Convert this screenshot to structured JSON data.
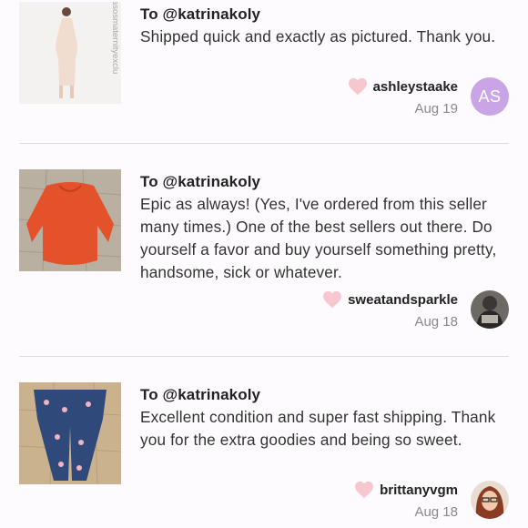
{
  "reviews": [
    {
      "to": "To @katrinakoly",
      "message": "Shipped quick and exactly as pictured. Thank you.",
      "username": "ashleystaake",
      "date": "Aug 19",
      "avatar_initials": "AS",
      "thumb_text": "asosmaternityexclu",
      "avatar_color": "#c9a4e6"
    },
    {
      "to": "To @katrinakoly",
      "message": "Epic as always! (Yes, I've ordered from this seller many times.) One of the best sellers out there. Do yourself a favor and buy yourself something pretty, handsome, sick or whatever.",
      "username": "sweatandsparkle",
      "date": "Aug 18"
    },
    {
      "to": "To @katrinakoly",
      "message": "Excellent condition and super fast shipping. Thank you for the extra goodies and being so sweet.",
      "username": "brittanyvgm",
      "date": "Aug 18"
    }
  ],
  "colors": {
    "heart": "#f7c7cf",
    "divider": "#dedbde",
    "date": "#8a8a8a"
  }
}
